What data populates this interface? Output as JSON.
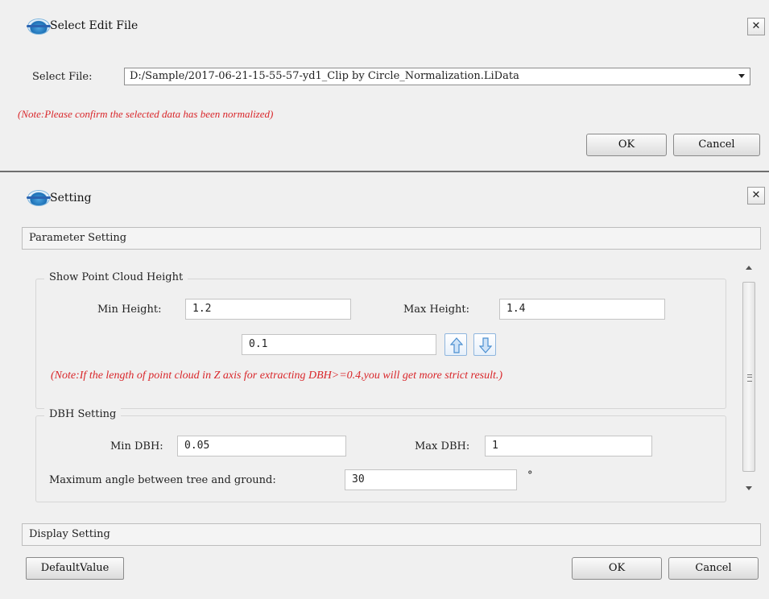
{
  "select_dialog": {
    "title": "Select Edit File",
    "close_label": "✕",
    "file_label": "Select File:",
    "file_value": "D:/Sample/2017-06-21-15-55-57-yd1_Clip by Circle_Normalization.LiData",
    "note": "(Note:Please confirm the selected data has been normalized)",
    "ok_label": "OK",
    "cancel_label": "Cancel"
  },
  "setting_dialog": {
    "title": "Setting",
    "close_label": "✕",
    "parameter_section": "Parameter Setting",
    "height_group": {
      "title": "Show Point Cloud Height",
      "min_label": "Min Height:",
      "min_value": "1.2",
      "max_label": "Max Height:",
      "max_value": "1.4",
      "step_value": "0.1",
      "note": "(Note:If the length of point cloud in Z axis for extracting DBH>=0.4,you will get more strict result.)"
    },
    "dbh_group": {
      "title": "DBH Setting",
      "min_label": "Min DBH:",
      "min_value": "0.05",
      "max_label": "Max DBH:",
      "max_value": "1",
      "angle_label": "Maximum angle between tree and ground:",
      "angle_value": "30",
      "angle_unit": "°"
    },
    "display_section": "Display Setting",
    "default_label": "DefaultValue",
    "ok_label": "OK",
    "cancel_label": "Cancel"
  },
  "colors": {
    "note_red": "#d9262a",
    "accent_blue": "#1c6fb5"
  }
}
